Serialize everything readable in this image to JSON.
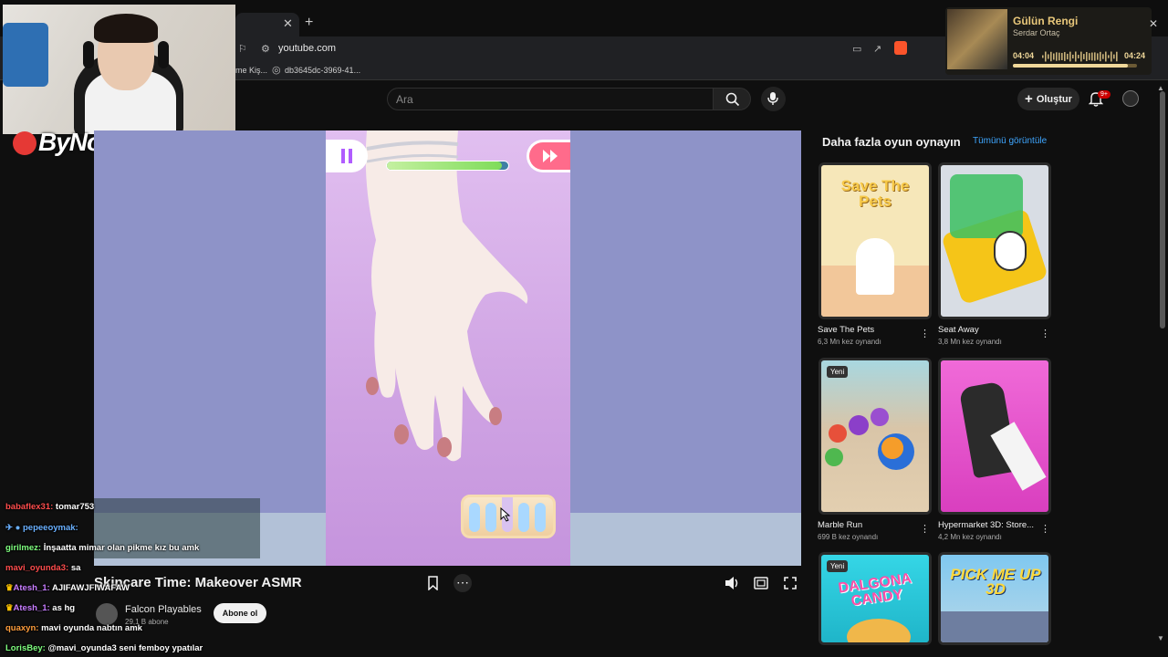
{
  "browser": {
    "url": "youtube.com",
    "bookmarks": [
      "me Kiş...",
      "db3645dc-3969-41..."
    ]
  },
  "youtube_header": {
    "search_placeholder": "Ara",
    "create_label": "Oluştur",
    "notification_count": "9+"
  },
  "streamer": {
    "logo_text": "ByNoGame"
  },
  "game": {
    "progress": 0.95
  },
  "video": {
    "title": "Skincare Time: Makeover ASMR",
    "channel": "Falcon Playables",
    "subscribers": "29,1 B abone",
    "subscribe_label": "Abone ol"
  },
  "chat": [
    {
      "user": "babaflex31:",
      "msg": "tomar753",
      "color": "#ff4d4d"
    },
    {
      "user": "pepeeoymak:",
      "msg": "",
      "color": "#6ab0ff"
    },
    {
      "user": "girilmez:",
      "msg": "İnşaatta mimar olan pikme kız bu amk",
      "color": "#7fff7f"
    },
    {
      "user": "mavi_oyunda3:",
      "msg": "sa",
      "color": "#ff4d4d"
    },
    {
      "user": "Atesh_1:",
      "msg": "AJIFAWJFIWAFAW",
      "color": "#c77dff"
    },
    {
      "user": "Atesh_1:",
      "msg": "as hg",
      "color": "#c77dff"
    },
    {
      "user": "quaxyn:",
      "msg": "mavi oyunda nabtın amk",
      "color": "#ff9d3c"
    },
    {
      "user": "LorisBey:",
      "msg": "@mavi_oyunda3 seni femboy ypatılar",
      "color": "#7fff7f"
    }
  ],
  "sidebar": {
    "title": "Daha fazla oyun oynayın",
    "see_all": "Tümünü görüntüle",
    "new_label": "Yeni",
    "games": [
      {
        "name": "Save The Pets",
        "plays": "6,3 Mn kez oynandı"
      },
      {
        "name": "Seat Away",
        "plays": "3,8 Mn kez oynandı"
      },
      {
        "name": "Marble Run",
        "plays": "699 B kez oynandı"
      },
      {
        "name": "Hypermarket 3D: Store...",
        "plays": "4,2 Mn kez oynandı"
      }
    ],
    "tiles": {
      "save_pets": "Save The Pets",
      "dalgona": "DALGONA CANDY",
      "pick": "PICK ME UP 3D"
    }
  },
  "music": {
    "title": "Gülün Rengi",
    "artist": "Serdar Ortaç",
    "elapsed": "04:04",
    "duration": "04:24"
  }
}
